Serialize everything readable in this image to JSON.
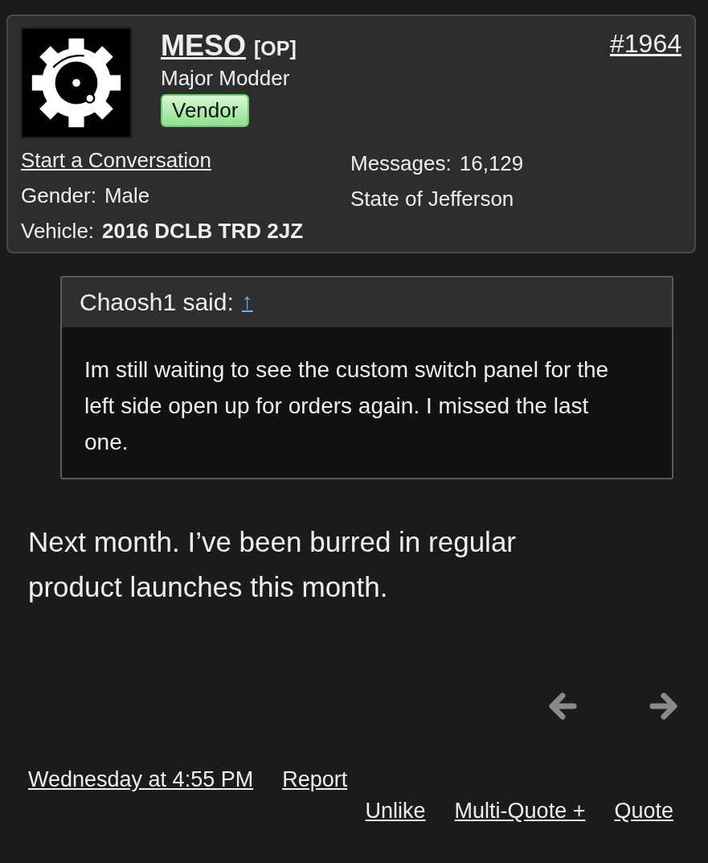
{
  "post": {
    "author": {
      "name": "MESO",
      "tag": "[OP]",
      "rank": "Major Modder",
      "badge": "Vendor"
    },
    "number": "#1964",
    "start_conversation": "Start a Conversation",
    "meta_left": [
      {
        "label": "Gender:",
        "value": "Male",
        "kind": "plain"
      },
      {
        "label": "Vehicle:",
        "value": "2016 DCLB TRD 2JZ",
        "kind": "bold"
      }
    ],
    "meta_right": [
      {
        "label": "Messages:",
        "value": "16,129"
      },
      {
        "value": "State of Jefferson"
      }
    ],
    "quote": {
      "header": "Chaosh1 said:",
      "jump": "↑",
      "text": "Im still waiting to see the custom switch panel for the left side open up for orders again. I missed the last one."
    },
    "body": "Next month. I’ve been burred in regular product launches this month.",
    "timestamp": "Wednesday at 4:55 PM",
    "actions_top": [
      "Report"
    ],
    "actions_bottom": [
      "Unlike",
      "Multi-Quote +",
      "Quote"
    ]
  }
}
